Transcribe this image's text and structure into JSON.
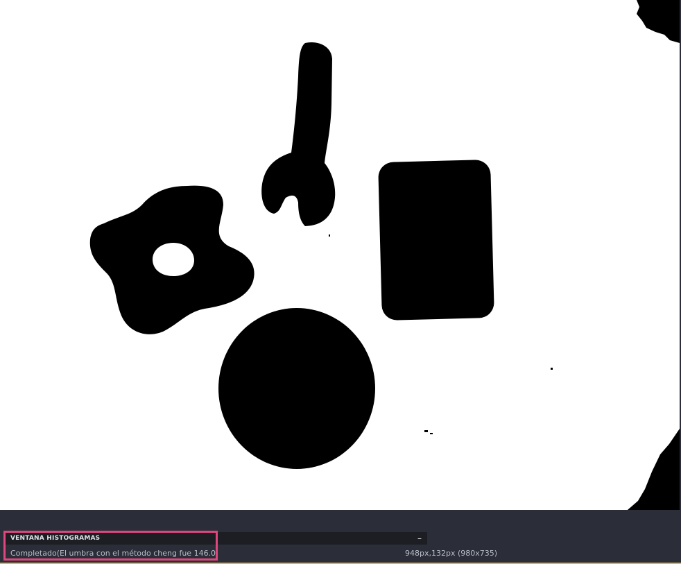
{
  "image_view": {
    "description_icon": "binary-thresholded-image",
    "colors": {
      "background": "#ffffff",
      "foreground": "#000000"
    }
  },
  "histogram_panel": {
    "title": "VENTANA HISTOGRAMAS",
    "minimize_label": "–"
  },
  "status": {
    "message": "Completado(El umbra con el método cheng fue 146.0",
    "coordinates": "948px,132px (980x735)"
  },
  "theme": {
    "panel_bg": "#2b2e38",
    "bar_bg": "#1c1e24",
    "highlight": "#e0477e"
  }
}
